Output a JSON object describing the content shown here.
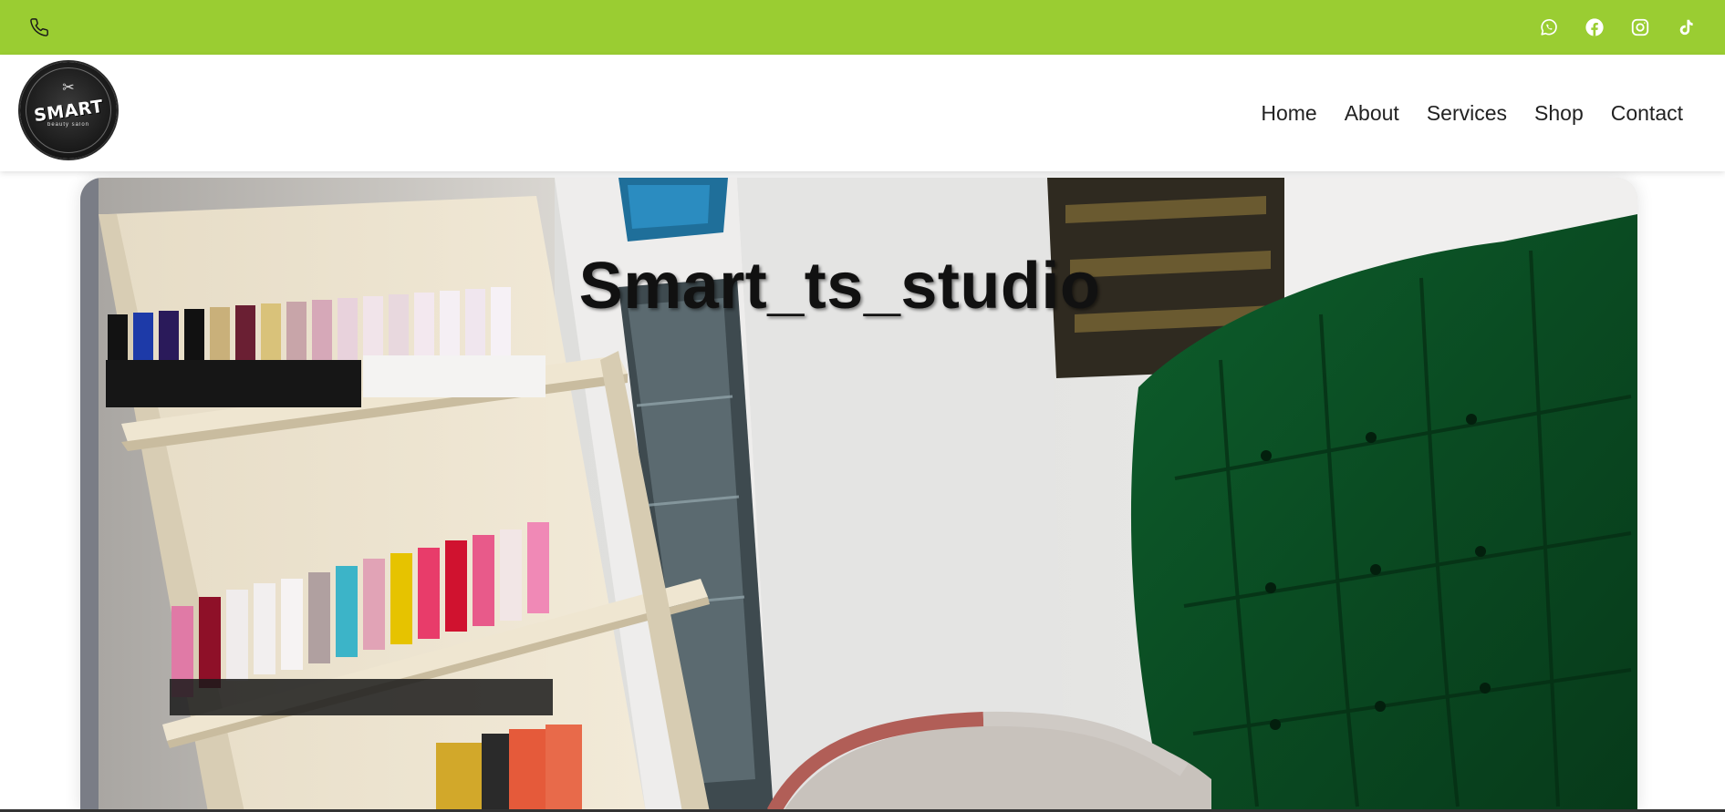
{
  "topbar": {
    "background": "#9acd32",
    "phone_icon": "phone-icon",
    "social_icons": [
      "whatsapp-icon",
      "facebook-icon",
      "instagram-icon",
      "tiktok-icon"
    ]
  },
  "header": {
    "logo_text": "SMART",
    "logo_subtext": "beauty salon",
    "nav": [
      {
        "label": "Home"
      },
      {
        "label": "About"
      },
      {
        "label": "Services"
      },
      {
        "label": "Shop"
      },
      {
        "label": "Contact"
      }
    ]
  },
  "hero": {
    "title": "Smart_ts_studio",
    "image_alt": "salon interior with nail polish shelves and green tufted chair"
  }
}
